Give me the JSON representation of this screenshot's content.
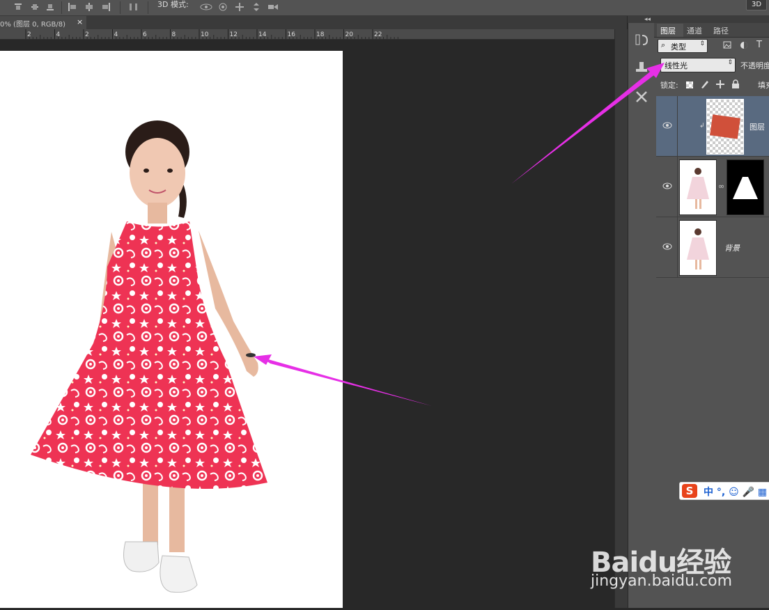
{
  "options_bar": {
    "mode3d_label": "3D 模式:",
    "btn_3d": "3D",
    "icons": [
      "align-top-icon",
      "align-vcenter-icon",
      "align-bottom-icon",
      "align-left-icon",
      "align-hcenter-icon",
      "align-right-icon",
      "distribute-icon",
      "rotate-3d-icon",
      "roll-3d-icon",
      "drag-3d-icon",
      "slide-3d-icon",
      "scale-3d-icon"
    ]
  },
  "document": {
    "tab_title": "0% (图层 0, RGB/8)",
    "tab_close": "×",
    "ruler_ticks": [
      "2",
      "4",
      "2",
      "4",
      "6",
      "8",
      "10",
      "12",
      "14",
      "16",
      "18",
      "20",
      "22"
    ]
  },
  "panels": {
    "collapse_glyph": "◂◂",
    "tabs": [
      "图层",
      "通道",
      "路径"
    ],
    "filter_value": "类型",
    "blend_mode": "线性光",
    "opacity_label": "不透明度",
    "lock_label": "锁定:",
    "fill_label": "填充",
    "layers": [
      {
        "name": "图层",
        "selected": true,
        "visible": true
      },
      {
        "name": "",
        "selected": false,
        "visible": true,
        "has_mask": true
      },
      {
        "name": "背景",
        "selected": false,
        "visible": true
      }
    ]
  },
  "ime": {
    "logo": "S",
    "text": "中 °, ☺ 🎤 ▦"
  },
  "watermark": {
    "logo": "Baidu经验",
    "url": "jingyan.baidu.com"
  },
  "colors": {
    "arrow": "#e62fe6",
    "dress": "#ee3354",
    "panel": "#535353",
    "selected_layer": "#596a80"
  }
}
